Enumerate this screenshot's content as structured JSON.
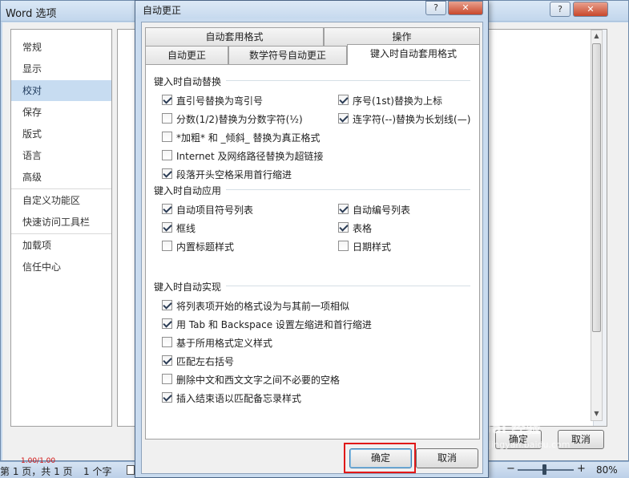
{
  "background_window": {
    "title": "Word 选项",
    "nav_items": [
      {
        "label": "常规"
      },
      {
        "label": "显示"
      },
      {
        "label": "校对",
        "active": true
      },
      {
        "label": "保存"
      },
      {
        "label": "版式"
      },
      {
        "label": "语言"
      },
      {
        "label": "高级"
      },
      {
        "label": "自定义功能区"
      },
      {
        "label": "快速访问工具栏"
      },
      {
        "label": "加载项"
      },
      {
        "label": "信任中心"
      }
    ],
    "ok_label": "确定",
    "cancel_label": "取消"
  },
  "dialog": {
    "title": "自动更正",
    "help_icon": "?",
    "close_icon": "✕",
    "tabs_row1": [
      {
        "label": "自动套用格式"
      },
      {
        "label": "操作"
      }
    ],
    "tabs_row2": [
      {
        "label": "自动更正"
      },
      {
        "label": "数学符号自动更正"
      },
      {
        "label": "键入时自动套用格式",
        "active": true
      }
    ],
    "groups": {
      "replace": {
        "label": "键入时自动替换",
        "left": [
          {
            "label": "直引号替换为弯引号",
            "checked": true
          },
          {
            "label": "分数(1/2)替换为分数字符(½)",
            "checked": false
          },
          {
            "label": "*加粗* 和 _倾斜_ 替换为真正格式",
            "checked": false
          },
          {
            "label": "Internet 及网络路径替换为超链接",
            "checked": false
          },
          {
            "label": "段落开头空格采用首行缩进",
            "checked": true
          }
        ],
        "right": [
          {
            "label": "序号(1st)替换为上标",
            "checked": true
          },
          {
            "label": "连字符(--)替换为长划线(—)",
            "checked": true
          }
        ]
      },
      "apply": {
        "label": "键入时自动应用",
        "left": [
          {
            "label": "自动项目符号列表",
            "checked": true
          },
          {
            "label": "框线",
            "checked": true
          },
          {
            "label": "内置标题样式",
            "checked": false
          }
        ],
        "right": [
          {
            "label": "自动编号列表",
            "checked": true
          },
          {
            "label": "表格",
            "checked": true
          },
          {
            "label": "日期样式",
            "checked": false
          }
        ]
      },
      "implement": {
        "label": "键入时自动实现",
        "items": [
          {
            "label": "将列表项开始的格式设为与其前一项相似",
            "checked": true
          },
          {
            "label": "用 Tab 和 Backspace 设置左缩进和首行缩进",
            "checked": true
          },
          {
            "label": "基于所用格式定义样式",
            "checked": false
          },
          {
            "label": "匹配左右括号",
            "checked": true
          },
          {
            "label": "删除中文和西文文字之间不必要的空格",
            "checked": false
          },
          {
            "label": "插入结束语以匹配备忘录样式",
            "checked": true
          }
        ]
      }
    },
    "ok_label": "确定",
    "cancel_label": "取消"
  },
  "statusbar": {
    "page": "第 1 页，共 1 页",
    "words": "1 个字",
    "zoom": "80%",
    "zoom_minus": "−",
    "zoom_plus": "+",
    "red_mark": "1.00/1.00"
  },
  "watermark": {
    "text": "Bai 经验",
    "sub": "jingyan.baidu.com"
  },
  "colors": {
    "highlight": "#e01818",
    "accent": "#c7dcf1"
  }
}
